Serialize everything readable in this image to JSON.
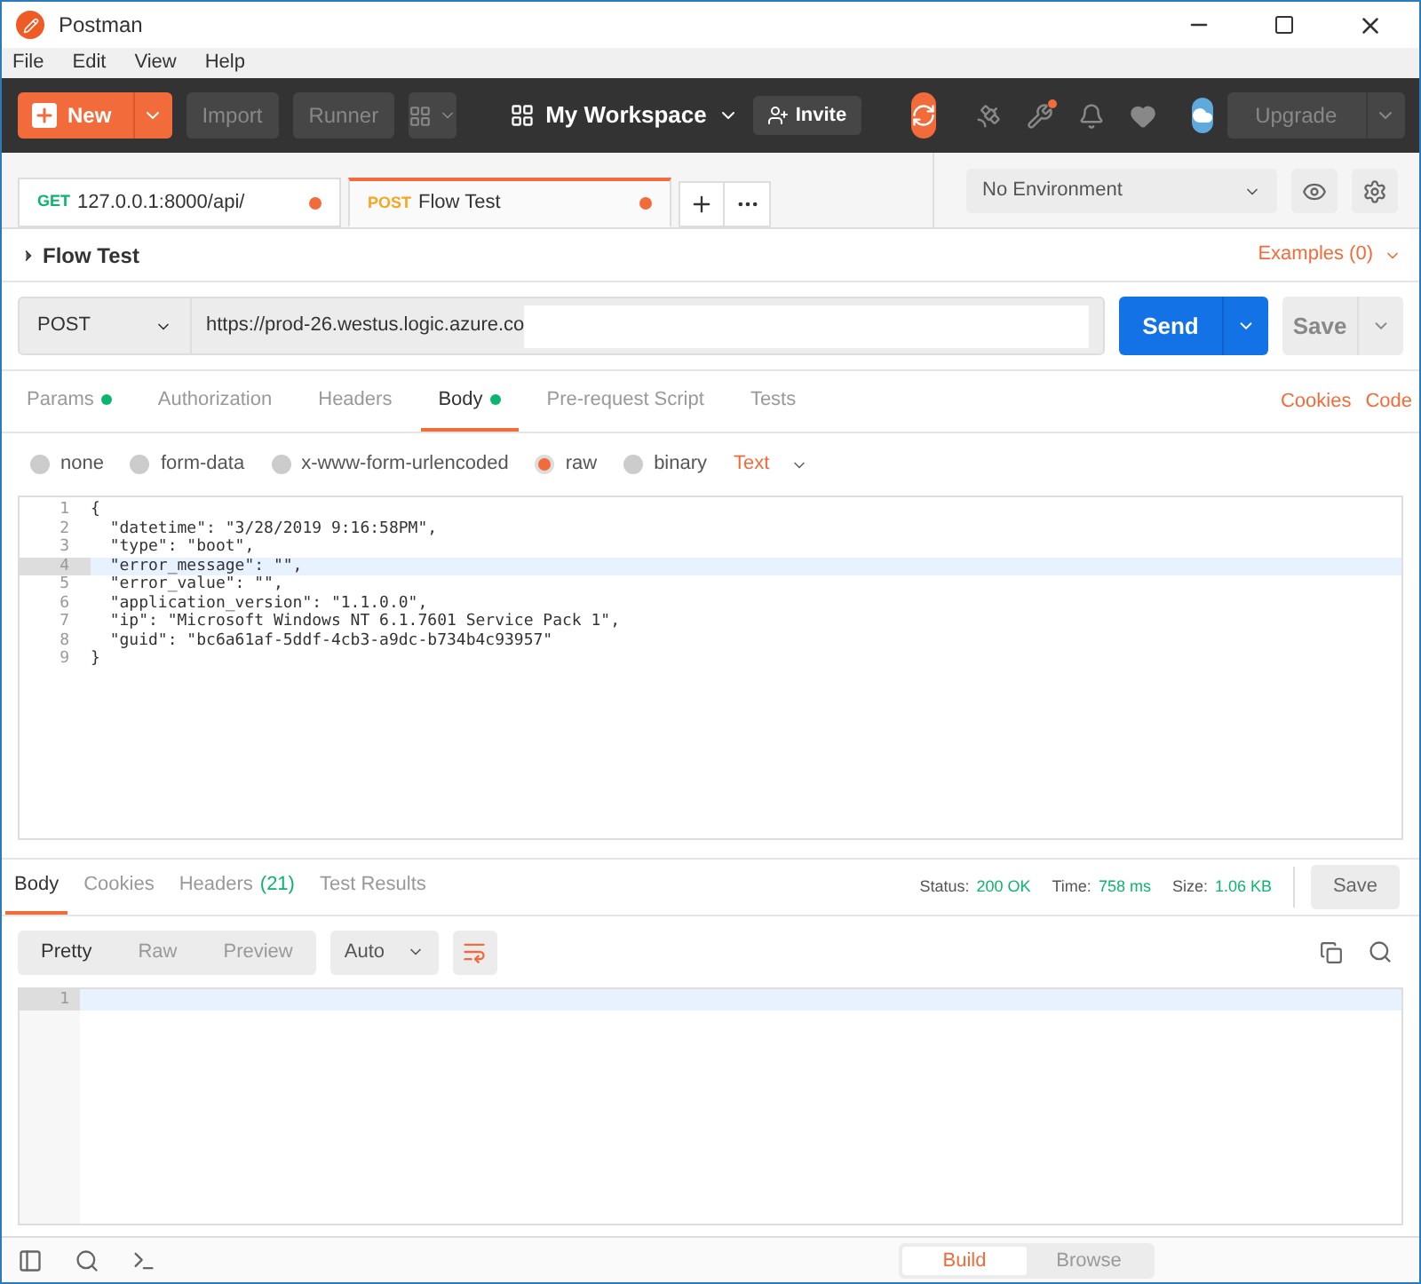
{
  "window": {
    "title": "Postman"
  },
  "menu": [
    "File",
    "Edit",
    "View",
    "Help"
  ],
  "toolbar": {
    "new": "New",
    "import": "Import",
    "runner": "Runner",
    "workspace": "My Workspace",
    "invite": "Invite",
    "upgrade": "Upgrade"
  },
  "tabs": [
    {
      "method": "GET",
      "label": "127.0.0.1:8000/api/",
      "selected": false
    },
    {
      "method": "POST",
      "label": "Flow Test",
      "selected": true
    }
  ],
  "environment": {
    "value": "No Environment"
  },
  "request": {
    "name": "Flow Test",
    "examples": "Examples (0)",
    "method": "POST",
    "url": "https://prod-26.westus.logic.azure.co",
    "send": "Send",
    "save": "Save"
  },
  "request_tabs": [
    {
      "label": "Params",
      "dot": true,
      "selected": false
    },
    {
      "label": "Authorization",
      "dot": false,
      "selected": false
    },
    {
      "label": "Headers",
      "dot": false,
      "selected": false
    },
    {
      "label": "Body",
      "dot": true,
      "selected": true
    },
    {
      "label": "Pre-request Script",
      "dot": false,
      "selected": false
    },
    {
      "label": "Tests",
      "dot": false,
      "selected": false
    }
  ],
  "links": [
    "Cookies",
    "Code"
  ],
  "body_types": [
    {
      "label": "none",
      "selected": false
    },
    {
      "label": "form-data",
      "selected": false
    },
    {
      "label": "x-www-form-urlencoded",
      "selected": false
    },
    {
      "label": "raw",
      "selected": true
    },
    {
      "label": "binary",
      "selected": false
    }
  ],
  "raw_format": "Text",
  "editor": {
    "lines": [
      {
        "n": "1",
        "text": "{",
        "active": false
      },
      {
        "n": "2",
        "text": "  \"datetime\": \"3/28/2019 9:16:58PM\",",
        "active": false
      },
      {
        "n": "3",
        "text": "  \"type\": \"boot\",",
        "active": false
      },
      {
        "n": "4",
        "text": "  \"error_message\": \"\",",
        "active": true
      },
      {
        "n": "5",
        "text": "  \"error_value\": \"\",",
        "active": false
      },
      {
        "n": "6",
        "text": "  \"application_version\": \"1.1.0.0\",",
        "active": false
      },
      {
        "n": "7",
        "text": "  \"ip\": \"Microsoft Windows NT 6.1.7601 Service Pack 1\",",
        "active": false
      },
      {
        "n": "8",
        "text": "  \"guid\": \"bc6a61af-5ddf-4cb3-a9dc-b734b4c93957\"",
        "active": false
      },
      {
        "n": "9",
        "text": "}",
        "active": false
      }
    ]
  },
  "response_tabs": [
    {
      "label": "Body",
      "selected": true
    },
    {
      "label": "Cookies",
      "selected": false
    },
    {
      "label": "Headers",
      "count": "(21)",
      "selected": false
    },
    {
      "label": "Test Results",
      "selected": false
    }
  ],
  "response_stats": [
    {
      "label": "Status:",
      "value": "200 OK"
    },
    {
      "label": "Time:",
      "value": "758 ms"
    },
    {
      "label": "Size:",
      "value": "1.06 KB"
    }
  ],
  "response_save": "Save",
  "view_modes": [
    {
      "label": "Pretty",
      "selected": true
    },
    {
      "label": "Raw",
      "selected": false
    },
    {
      "label": "Preview",
      "selected": false
    }
  ],
  "format": "Auto",
  "response_lines": [
    "1"
  ],
  "status_bar": {
    "modes": [
      {
        "label": "Build",
        "selected": true
      },
      {
        "label": "Browse",
        "selected": false
      }
    ]
  }
}
